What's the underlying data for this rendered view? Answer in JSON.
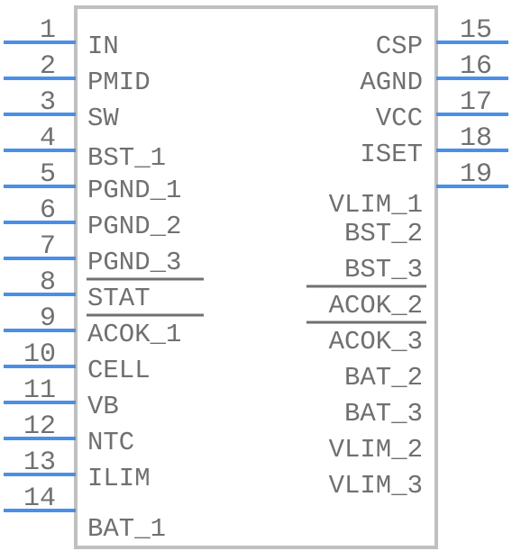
{
  "component": {
    "type": "ic-schematic-symbol",
    "colors": {
      "pin_line": "#4a8fe7",
      "text": "#707070",
      "body_outline": "#c0c0c0",
      "background": "#ffffff"
    }
  },
  "left_pins": [
    {
      "number": "1",
      "name": "IN",
      "active_low": false
    },
    {
      "number": "2",
      "name": "PMID",
      "active_low": false
    },
    {
      "number": "3",
      "name": "SW",
      "active_low": false
    },
    {
      "number": "4",
      "name": "BST_1",
      "active_low": false
    },
    {
      "number": "5",
      "name": "PGND_1",
      "active_low": false
    },
    {
      "number": "6",
      "name": "PGND_2",
      "active_low": false
    },
    {
      "number": "7",
      "name": "PGND_3",
      "active_low": false
    },
    {
      "number": "8",
      "name": "STAT",
      "active_low": true
    },
    {
      "number": "9",
      "name": "ACOK_1",
      "active_low": true
    },
    {
      "number": "10",
      "name": "CELL",
      "active_low": false
    },
    {
      "number": "11",
      "name": "VB",
      "active_low": false
    },
    {
      "number": "12",
      "name": "NTC",
      "active_low": false
    },
    {
      "number": "13",
      "name": "ILIM",
      "active_low": false
    },
    {
      "number": "14",
      "name": "BAT_1",
      "active_low": false
    }
  ],
  "right_pins": [
    {
      "number": "15",
      "name": "CSP",
      "active_low": false
    },
    {
      "number": "16",
      "name": "AGND",
      "active_low": false
    },
    {
      "number": "17",
      "name": "VCC",
      "active_low": false
    },
    {
      "number": "18",
      "name": "ISET",
      "active_low": false
    },
    {
      "number": "19",
      "name": "VLIM_1",
      "active_low": false
    }
  ],
  "right_labels_unconnected": [
    {
      "name": "BST_2",
      "active_low": false
    },
    {
      "name": "BST_3",
      "active_low": false
    },
    {
      "name": "ACOK_2",
      "active_low": true
    },
    {
      "name": "ACOK_3",
      "active_low": true
    },
    {
      "name": "BAT_2",
      "active_low": false
    },
    {
      "name": "BAT_3",
      "active_low": false
    },
    {
      "name": "VLIM_2",
      "active_low": false
    },
    {
      "name": "VLIM_3",
      "active_low": false
    }
  ]
}
